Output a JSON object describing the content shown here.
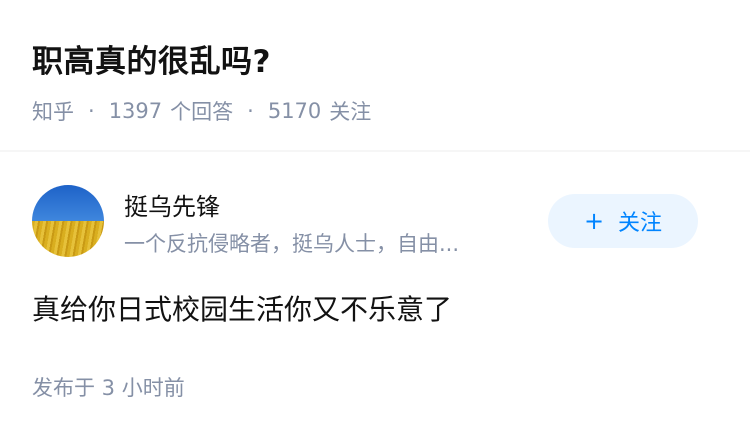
{
  "question": {
    "title": "职高真的很乱吗?",
    "source": "知乎",
    "separator": "·",
    "answer_count": "1397",
    "answer_label": "个回答",
    "follower_count": "5170",
    "follower_label": "关注"
  },
  "author": {
    "name": "挺乌先锋",
    "bio": "一个反抗侵略者，挺乌人士，自由...",
    "avatar_icon": "ukraine-field-avatar"
  },
  "follow_button": {
    "icon": "+",
    "label": "关注",
    "bg_color": "#ebf5ff",
    "text_color": "#0084ff"
  },
  "answer": {
    "text": "真给你日式校园生活你又不乐意了",
    "time": "发布于 3 小时前"
  }
}
